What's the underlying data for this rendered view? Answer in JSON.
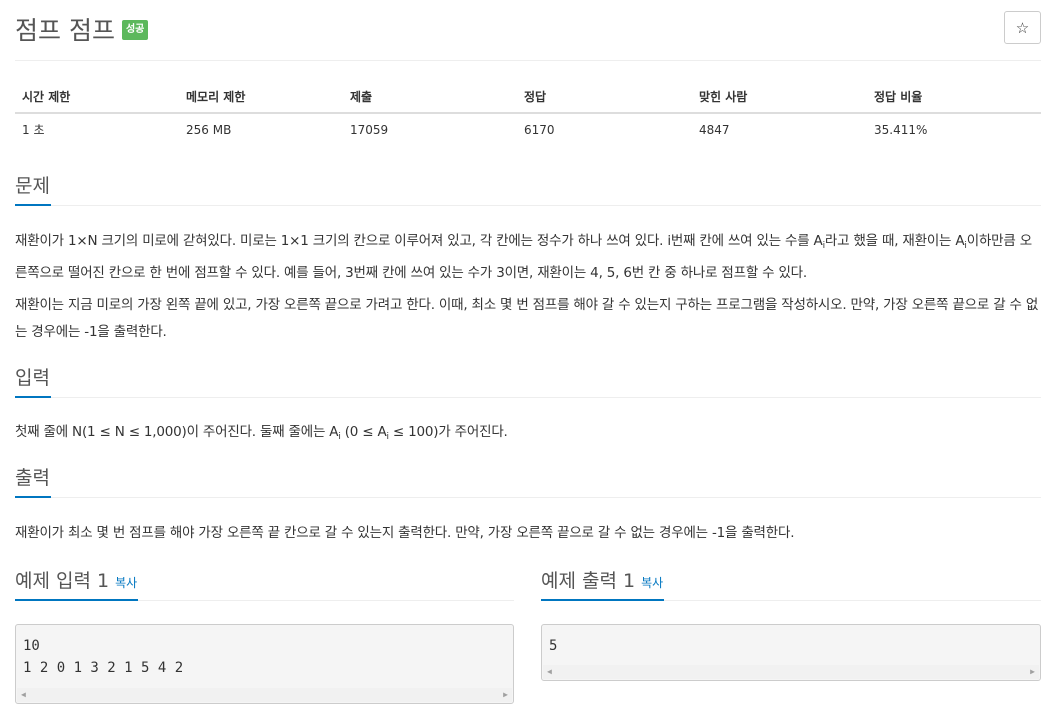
{
  "header": {
    "title": "점프 점프",
    "badge": "성공",
    "star_icon": "☆"
  },
  "info_table": {
    "headers": [
      "시간 제한",
      "메모리 제한",
      "제출",
      "정답",
      "맞힌 사람",
      "정답 비율"
    ],
    "values": [
      "1 초",
      "256 MB",
      "17059",
      "6170",
      "4847",
      "35.411%"
    ]
  },
  "problem": {
    "heading": "문제",
    "p1_a": "재환이가 1×N 크기의 미로에 갇혀있다. 미로는 1×1 크기의 칸으로 이루어져 있고, 각 칸에는 정수가 하나 쓰여 있다. i번째 칸에 쓰여 있는 수를 A",
    "p1_sub1": "i",
    "p1_b": "라고 했을 때, 재환이는 A",
    "p1_sub2": "i",
    "p1_c": "이하만큼 오른쪽으로 떨어진 칸으로 한 번에 점프할 수 있다. 예를 들어, 3번째 칸에 쓰여 있는 수가 3이면, 재환이는 4, 5, 6번 칸 중 하나로 점프할 수 있다.",
    "p2": "재환이는 지금 미로의 가장 왼쪽 끝에 있고, 가장 오른쪽 끝으로 가려고 한다. 이때, 최소 몇 번 점프를 해야 갈 수 있는지 구하는 프로그램을 작성하시오. 만약, 가장 오른쪽 끝으로 갈 수 없는 경우에는 -1을 출력한다."
  },
  "input": {
    "heading": "입력",
    "text_a": "첫째 줄에 N(1 ≤ N ≤ 1,000)이 주어진다. 둘째 줄에는 A",
    "sub1": "i",
    "text_b": " (0 ≤ A",
    "sub2": "i",
    "text_c": " ≤ 100)가 주어진다."
  },
  "output": {
    "heading": "출력",
    "text": "재환이가 최소 몇 번 점프를 해야 가장 오른쪽 끝 칸으로 갈 수 있는지 출력한다. 만약, 가장 오른쪽 끝으로 갈 수 없는 경우에는 -1을 출력한다."
  },
  "sample_input": {
    "heading": "예제 입력 1",
    "copy": "복사",
    "text": "10\n1 2 0 1 3 2 1 5 4 2"
  },
  "sample_output": {
    "heading": "예제 출력 1",
    "copy": "복사",
    "text": "5"
  },
  "scrollbar": {
    "left_arrow": "◀",
    "right_arrow": "▶"
  },
  "colors": {
    "badge": "#5cb85c",
    "accent": "#0076c0"
  }
}
